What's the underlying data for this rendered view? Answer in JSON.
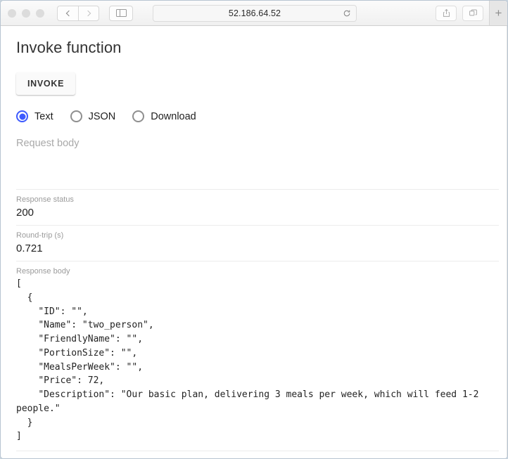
{
  "browser": {
    "url": "52.186.64.52",
    "traffic_lights": [
      "close",
      "minimize",
      "maximize"
    ],
    "back_label": "Back",
    "forward_label": "Forward",
    "sidebar_label": "Show sidebar",
    "reload_label": "Reload",
    "share_label": "Share",
    "tabs_label": "Show tab overview",
    "new_tab_label": "+"
  },
  "page": {
    "title": "Invoke function",
    "invoke_button": "INVOKE",
    "radio_options": [
      {
        "label": "Text",
        "selected": true
      },
      {
        "label": "JSON",
        "selected": false
      },
      {
        "label": "Download",
        "selected": false
      }
    ],
    "request_body": {
      "placeholder": "Request body",
      "value": ""
    },
    "response_status": {
      "label": "Response status",
      "value": "200"
    },
    "round_trip": {
      "label": "Round-trip (s)",
      "value": "0.721"
    },
    "response_body": {
      "label": "Response body",
      "value": "[\n  {\n    \"ID\": \"\",\n    \"Name\": \"two_person\",\n    \"FriendlyName\": \"\",\n    \"PortionSize\": \"\",\n    \"MealsPerWeek\": \"\",\n    \"Price\": 72,\n    \"Description\": \"Our basic plan, delivering 3 meals per week, which will feed 1-2 people.\"\n  }\n]"
    }
  },
  "colors": {
    "accent": "#3d5afe",
    "text": "#212121",
    "muted": "#9b9b9b",
    "divider": "#ececec"
  }
}
